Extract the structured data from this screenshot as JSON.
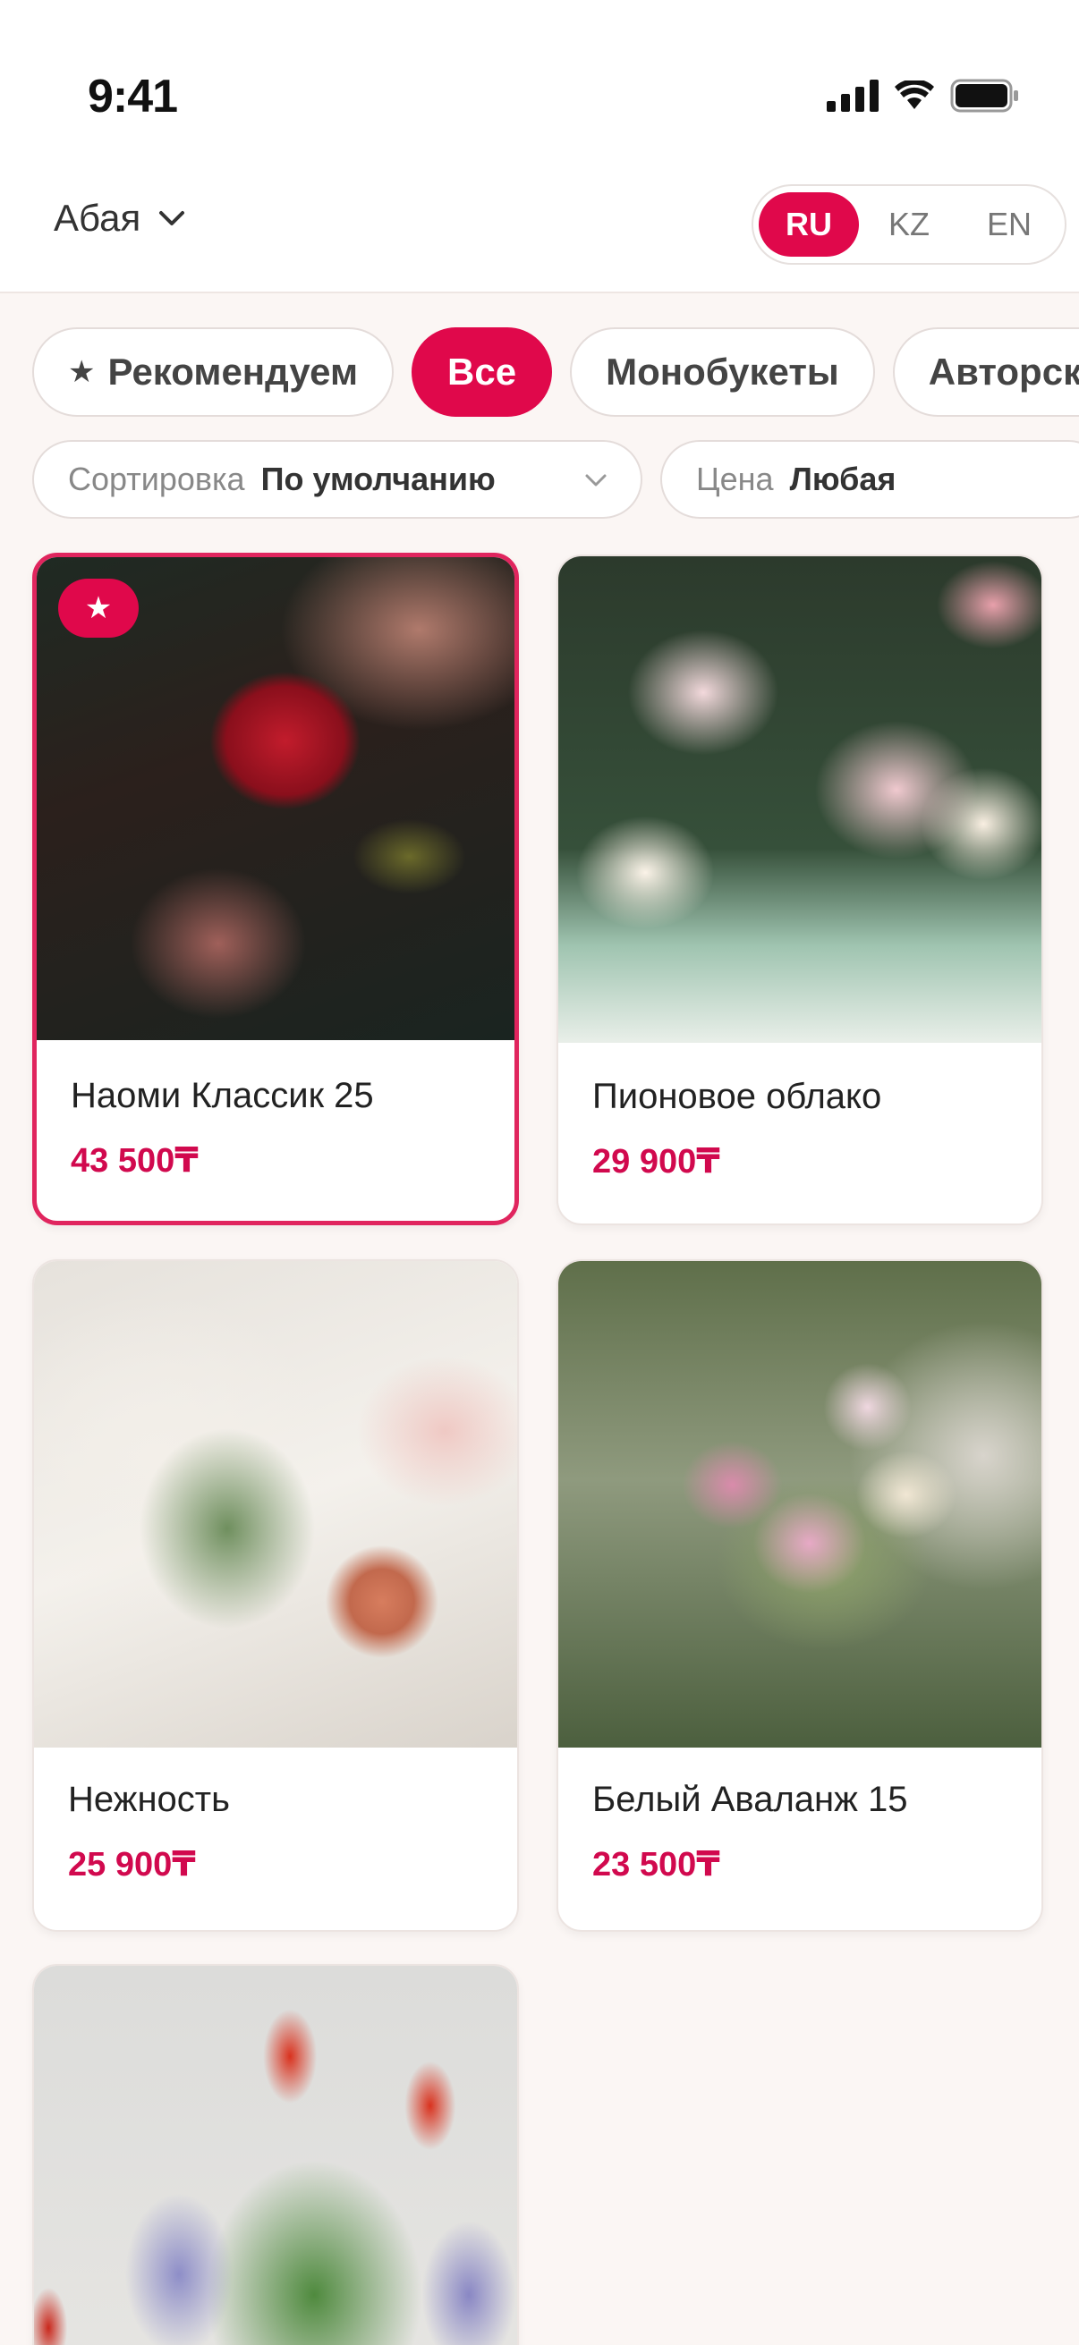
{
  "status_bar": {
    "time": "9:41"
  },
  "header": {
    "city": "Абая",
    "languages": [
      {
        "code": "RU",
        "active": true
      },
      {
        "code": "KZ",
        "active": false
      },
      {
        "code": "EN",
        "active": false
      }
    ]
  },
  "categories": [
    {
      "label": "Рекомендуем",
      "icon": "star-icon",
      "active": false
    },
    {
      "label": "Все",
      "active": true
    },
    {
      "label": "Монобукеты",
      "active": false
    },
    {
      "label": "Авторские",
      "active": false
    }
  ],
  "filters": {
    "sort": {
      "label": "Сортировка",
      "value": "По умолчанию"
    },
    "price": {
      "label": "Цена",
      "value": "Любая"
    }
  },
  "products": [
    {
      "name": "Наоми Классик 25",
      "price": "43 500₸",
      "recommended": true,
      "selected": true
    },
    {
      "name": "Пионовое облако",
      "price": "29 900₸",
      "recommended": false,
      "selected": false
    },
    {
      "name": "Нежность",
      "price": "25 900₸",
      "recommended": false,
      "selected": false
    },
    {
      "name": "Белый Аваланж 15",
      "price": "23 500₸",
      "recommended": false,
      "selected": false
    },
    {
      "name": "",
      "price": "",
      "recommended": false,
      "selected": false
    }
  ],
  "colors": {
    "accent": "#e0084b",
    "price": "#d1094e",
    "background": "#fbf6f4"
  }
}
